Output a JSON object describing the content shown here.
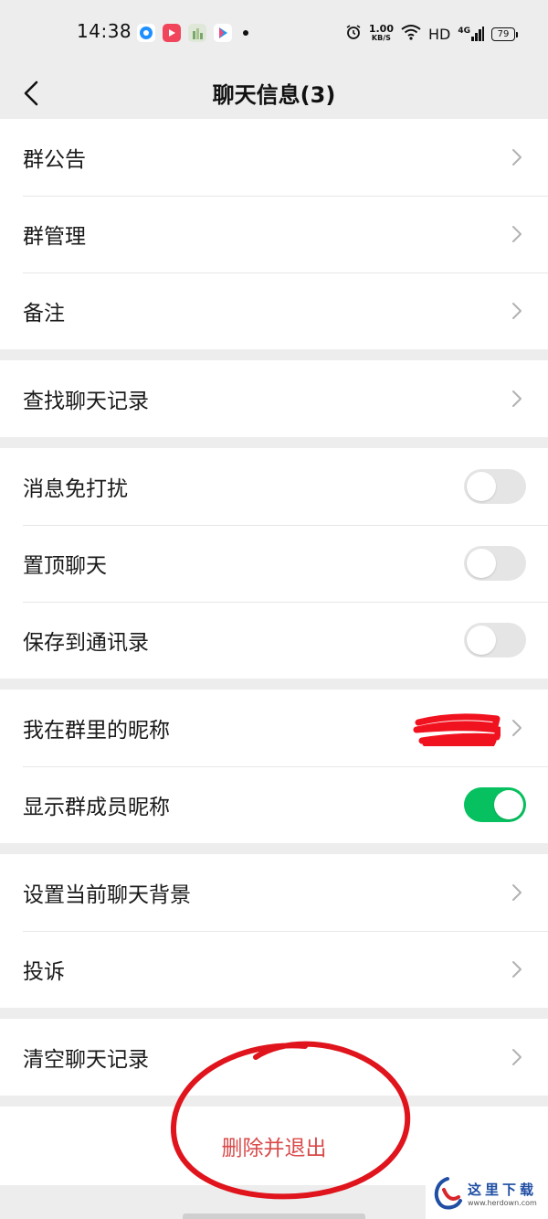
{
  "status_bar": {
    "time": "14:38",
    "net_speed_value": "1.00",
    "net_speed_unit": "KB/S",
    "hd_label": "HD",
    "network_label": "4G",
    "battery_level": "79"
  },
  "nav": {
    "title": "聊天信息(3)"
  },
  "groups": [
    {
      "rows": [
        {
          "label": "群公告"
        },
        {
          "label": "群管理"
        },
        {
          "label": "备注"
        }
      ]
    },
    {
      "rows": [
        {
          "label": "查找聊天记录"
        }
      ]
    },
    {
      "rows": [
        {
          "label": "消息免打扰",
          "toggle": false
        },
        {
          "label": "置顶聊天",
          "toggle": false
        },
        {
          "label": "保存到通讯录",
          "toggle": false
        }
      ]
    },
    {
      "rows": [
        {
          "label": "我在群里的昵称"
        },
        {
          "label": "显示群成员昵称",
          "toggle": true
        }
      ]
    },
    {
      "rows": [
        {
          "label": "设置当前聊天背景"
        },
        {
          "label": "投诉"
        }
      ]
    },
    {
      "rows": [
        {
          "label": "清空聊天记录"
        }
      ]
    }
  ],
  "delete_button": {
    "label": "删除并退出"
  },
  "watermark": {
    "cn": "这里下载",
    "url": "www.herdown.com"
  },
  "colors": {
    "toggle_on": "#07c160",
    "toggle_off": "#e5e5e5",
    "danger": "#d94a4a",
    "annotation": "#e0141c"
  }
}
